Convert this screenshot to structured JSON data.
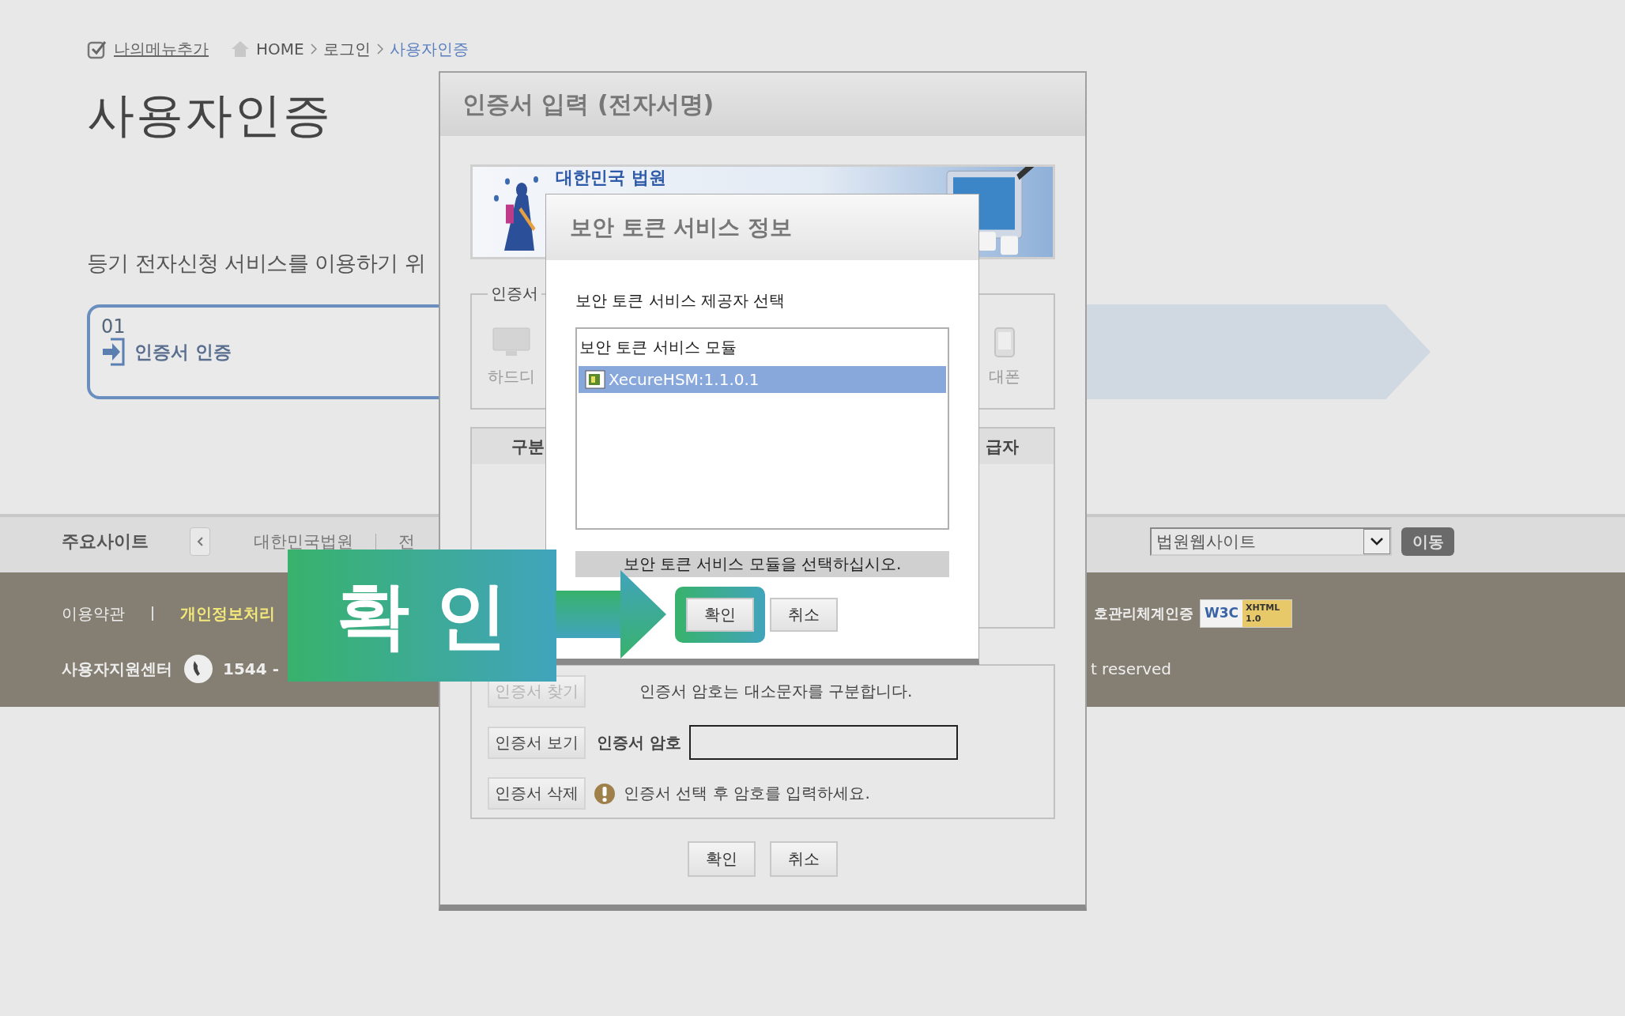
{
  "breadcrumb": {
    "my_menu": "나의메뉴추가",
    "items": [
      {
        "label": "HOME",
        "current": false
      },
      {
        "label": "로그인",
        "current": false
      },
      {
        "label": "사용자인증",
        "current": true
      }
    ]
  },
  "page_title": "사용자인증",
  "intro": "등기 전자신청 서비스를 이용하기 위",
  "steps": [
    {
      "number": "01",
      "label": "인증서 인증",
      "active": true
    },
    {
      "active": false
    }
  ],
  "site_bar": {
    "label": "주요사이트",
    "sites": [
      "대한민국법원",
      "전"
    ],
    "select": "법원웹사이트",
    "go_button": "이동"
  },
  "footer": {
    "links": [
      {
        "label": "이용약관",
        "highlight": false
      },
      {
        "label": "개인정보처리",
        "highlight": true
      }
    ],
    "certification": "호관리체계인증",
    "badge": {
      "left": "W3C",
      "right": "XHTML 1.0"
    },
    "support_label": "사용자지원센터",
    "phone": "1544 -",
    "rights": "t reserved"
  },
  "cert_dialog": {
    "title": "인증서 입력 (전자서명)",
    "banner_text": "대한민국 법원",
    "storage": {
      "legend": "인증서",
      "options": [
        {
          "label": "하드디",
          "kind": "disk"
        },
        {
          "label": "대폰",
          "kind": "phone"
        }
      ]
    },
    "table": {
      "columns": [
        "구분",
        "급자"
      ]
    },
    "actions": [
      {
        "label": "인증서 찾기",
        "disabled": true
      },
      {
        "label": "인증서 보기",
        "disabled": false
      },
      {
        "label": "인증서 삭제",
        "disabled": false
      }
    ],
    "case_note": "인증서 암호는 대소문자를 구분합니다.",
    "password_label": "인증서 암호",
    "warning": "인증서 선택 후 암호를 입력하세요.",
    "buttons": [
      "확인",
      "취소"
    ]
  },
  "token_dialog": {
    "title": "보안 토큰 서비스 정보",
    "prompt": "보안 토큰 서비스 제공자 선택",
    "list": {
      "header": "보안 토큰 서비스 모듈",
      "items": [
        {
          "label": "XecureHSM:1.1.0.1",
          "selected": true
        }
      ]
    },
    "status": "보안 토큰 서비스 모듈을 선택하십시오.",
    "buttons": [
      {
        "label": "확인",
        "highlighted": true
      },
      {
        "label": "취소",
        "highlighted": false
      }
    ]
  },
  "callout": {
    "label": "확 인"
  }
}
